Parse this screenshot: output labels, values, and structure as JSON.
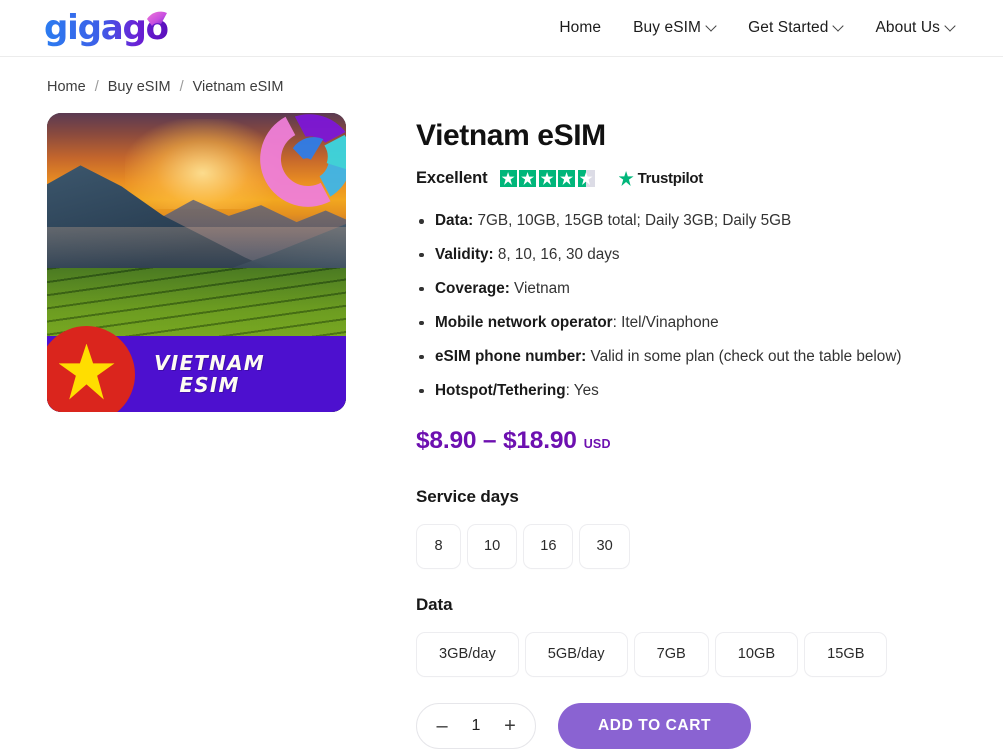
{
  "header": {
    "logo_text": "gigago",
    "nav": [
      {
        "label": "Home",
        "has_dropdown": false
      },
      {
        "label": "Buy eSIM",
        "has_dropdown": true
      },
      {
        "label": "Get Started",
        "has_dropdown": true
      },
      {
        "label": "About Us",
        "has_dropdown": true
      }
    ]
  },
  "breadcrumb": {
    "items": [
      "Home",
      "Buy eSIM",
      "Vietnam eSIM"
    ],
    "separator": "/"
  },
  "product": {
    "title": "Vietnam eSIM",
    "image": {
      "banner_text": "VIETNAM\nESIM",
      "banner_color": "#4d10cf",
      "flag_circle_color": "#da251d",
      "flag_star_color": "#ffde00",
      "alt": "Vietnam terraced rice fields at sunset"
    },
    "rating": {
      "word": "Excellent",
      "stars_filled": 4,
      "partial_fraction": 0.47,
      "stars_total": 5,
      "brand": "Trustpilot",
      "star_color": "#00b67a"
    },
    "specs": [
      {
        "label": "Data:",
        "value": " 7GB, 10GB, 15GB total; Daily 3GB; Daily 5GB"
      },
      {
        "label": "Validity:",
        "value": " 8, 10, 16, 30 days"
      },
      {
        "label": "Coverage:",
        "value": " Vietnam"
      },
      {
        "label": "Mobile network operator",
        "value": ": Itel/Vinaphone"
      },
      {
        "label": "eSIM phone number:",
        "value": " Valid in some plan (check out the table below)"
      },
      {
        "label": "Hotspot/Tethering",
        "value": ": Yes"
      }
    ],
    "price": {
      "range": "$8.90 – $18.90",
      "currency": "USD",
      "color": "#6d10b0"
    },
    "options": [
      {
        "title": "Service days",
        "name": "service-days",
        "choices": [
          "8",
          "10",
          "16",
          "30"
        ]
      },
      {
        "title": "Data",
        "name": "data",
        "choices": [
          "3GB/day",
          "5GB/day",
          "7GB",
          "10GB",
          "15GB"
        ]
      }
    ],
    "cart": {
      "decrement": "–",
      "quantity": "1",
      "increment": "+",
      "add_label": "ADD TO CART",
      "button_color": "#8a63d2"
    }
  }
}
